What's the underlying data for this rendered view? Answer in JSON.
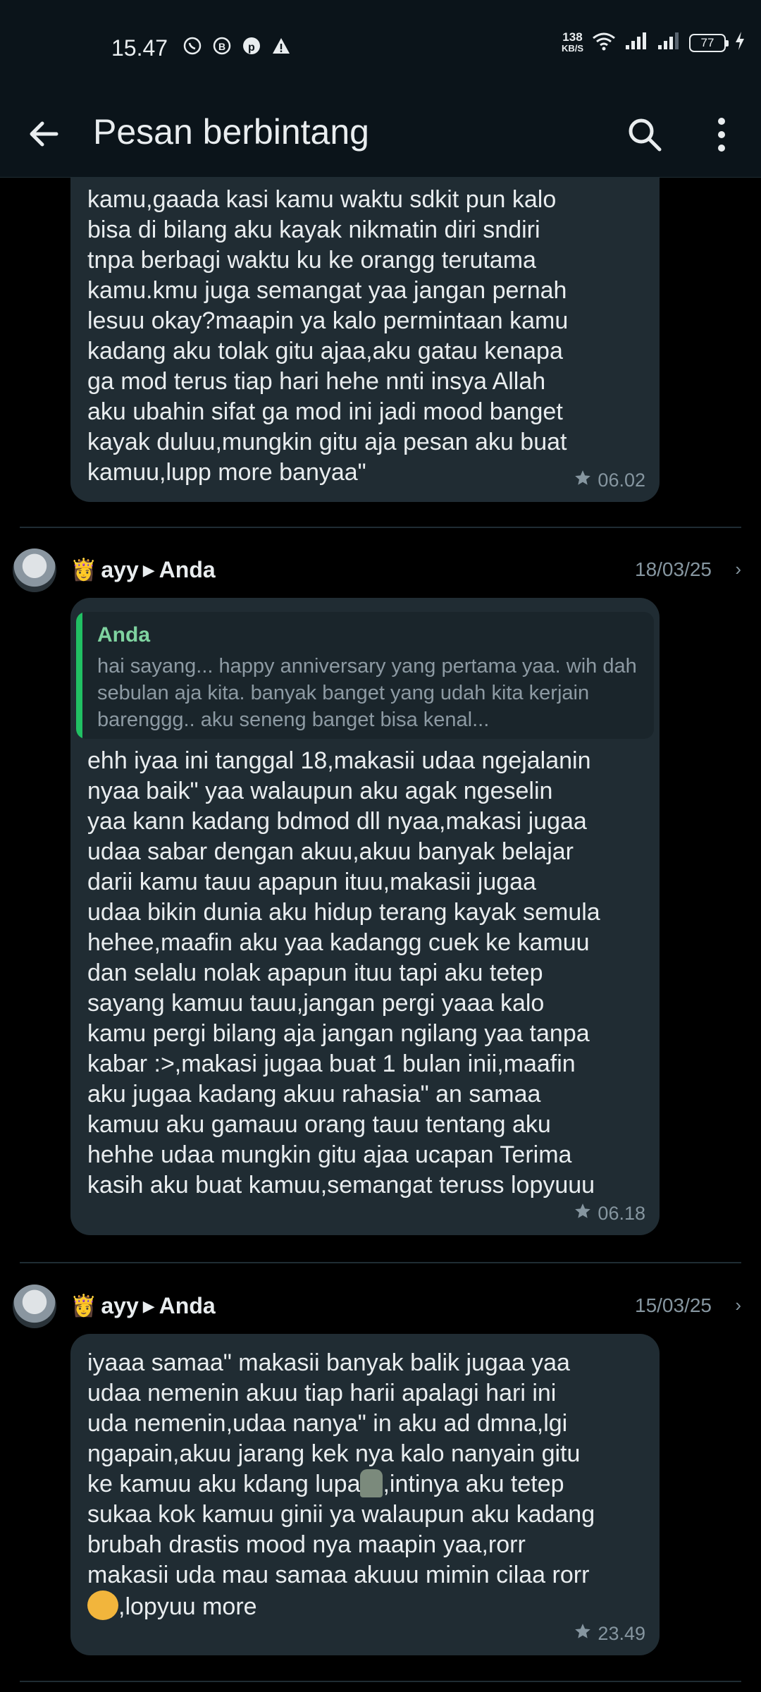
{
  "status_bar": {
    "time": "15.47",
    "net_speed_top": "138",
    "net_speed_unit": "KB/S",
    "battery": "77",
    "icons": [
      "whatsapp-icon",
      "b-icon",
      "pinterest-icon",
      "warning-icon",
      "wifi-icon",
      "signal-icon",
      "signal-icon",
      "battery-icon",
      "charging-icon"
    ]
  },
  "appbar": {
    "title": "Pesan berbintang"
  },
  "messages": [
    {
      "text": "kamu,gaada kasi kamu waktu sdkit pun kalo\nbisa di bilang aku kayak nikmatin diri sndiri\ntnpa berbagi waktu ku ke orangg terutama\nkamu.kmu juga semangat yaa jangan pernah\nlesuu okay?maapin ya kalo permintaan kamu\nkadang aku tolak gitu ajaa,aku gatau kenapa\nga mod terus tiap hari hehe nnti insya Allah\naku ubahin sifat ga mod ini jadi mood banget\nkayak duluu,mungkin gitu aja pesan aku buat\nkamuu,lupp more banyaa\"",
      "time": "06.02"
    },
    {
      "sender": "ayy",
      "recipient": "Anda",
      "date": "18/03/25",
      "quote_name": "Anda",
      "quote_text": "hai sayang... happy anniversary yang pertama yaa. wih dah sebulan aja kita. banyak banget yang udah kita kerjain barenggg.. aku seneng banget bisa kenal...",
      "text": "ehh iyaa ini tanggal 18,makasii udaa ngejalanin\nnyaa baik\" yaa walaupun aku agak ngeselin\nyaa kann kadang bdmod dll nyaa,makasi jugaa\nudaa sabar dengan akuu,akuu banyak belajar\ndarii kamu tauu apapun ituu,makasii jugaa\nudaa bikin dunia aku hidup terang kayak semula\nhehee,maafin aku yaa kadangg cuek ke kamuu\ndan selalu nolak apapun ituu tapi aku tetep\nsayang kamuu tauu,jangan pergi yaaa kalo\nkamu pergi bilang aja jangan ngilang yaa tanpa\nkabar :>,makasi jugaa buat 1 bulan inii,maafin\naku jugaa kadang akuu rahasia\" an samaa\nkamuu aku gamauu orang tauu tentang aku\nhehhe udaa mungkin gitu ajaa ucapan Terima\nkasih aku buat kamuu,semangat teruss lopyuuu",
      "time": "06.18"
    },
    {
      "sender": "ayy",
      "recipient": "Anda",
      "date": "15/03/25",
      "text_part1": "iyaaa samaa\" makasii banyak balik jugaa yaa\nudaa nemenin akuu tiap harii apalagi hari ini\nuda nemenin,udaa nanya\" in aku ad dmna,lgi\nngapain,akuu jarang kek nya kalo nanyain gitu\nke kamuu aku kdang lupa",
      "text_part2": ",intinya aku tetep\nsukaa kok kamuu ginii ya walaupun aku kadang\nbrubah drastis mood nya maapin yaa,rorr\nmakasii uda mau samaa akuuu mimin cilaa rorr\n",
      "text_part3": ",lopyuu more",
      "time": "23.49"
    }
  ]
}
